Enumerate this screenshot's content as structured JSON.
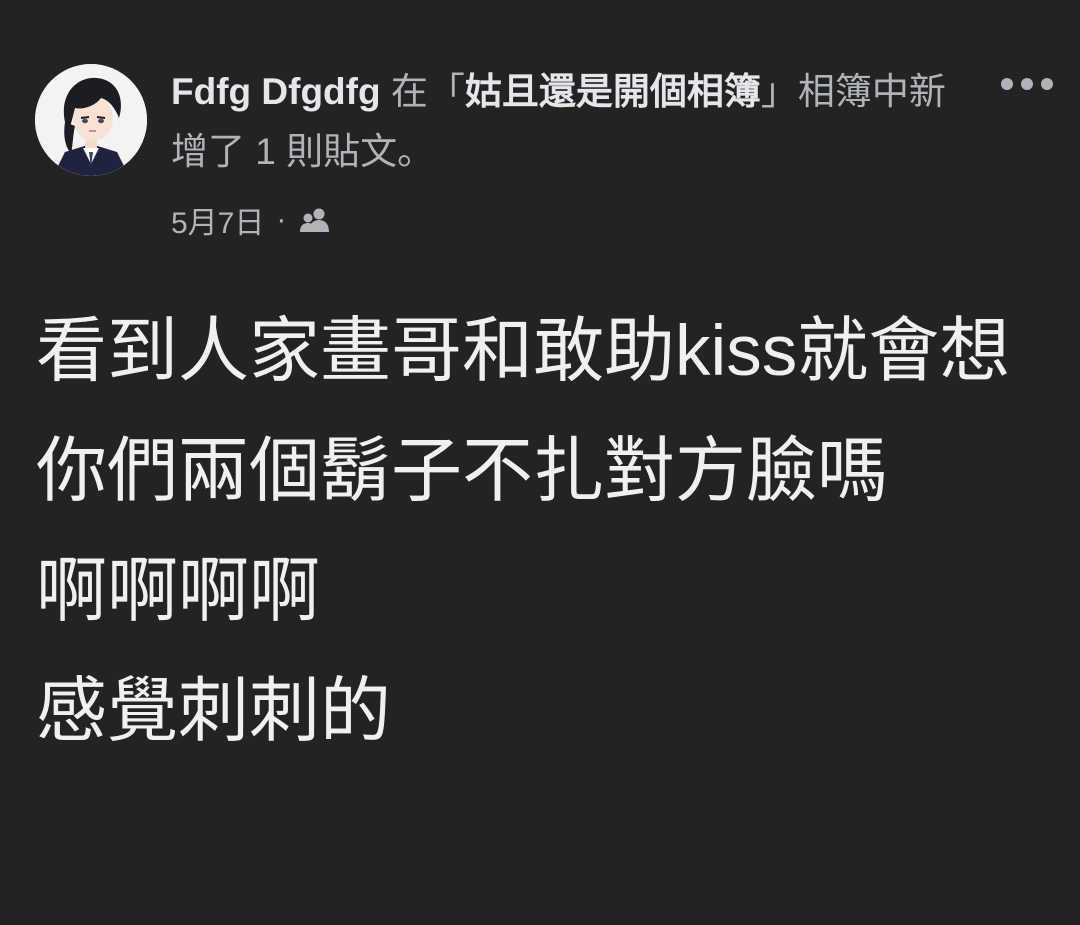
{
  "post": {
    "author": "Fdfg Dfgdfg",
    "action_prefix": " 在「",
    "album_name": "姑且還是開個相簿",
    "action_suffix": "」相簿中新增了 1 則貼文。",
    "date": "5月7日",
    "separator": "·",
    "audience_icon": "friends-icon",
    "more_icon": "more-horizontal-icon",
    "body_lines": [
      "看到人家畫哥和敢助kiss就會想",
      "你們兩個鬍子不扎對方臉嗎",
      "啊啊啊啊",
      "感覺刺刺的"
    ]
  },
  "colors": {
    "background": "#232323",
    "primary_text": "#e4e6eb",
    "secondary_text": "#b0b3b8"
  }
}
